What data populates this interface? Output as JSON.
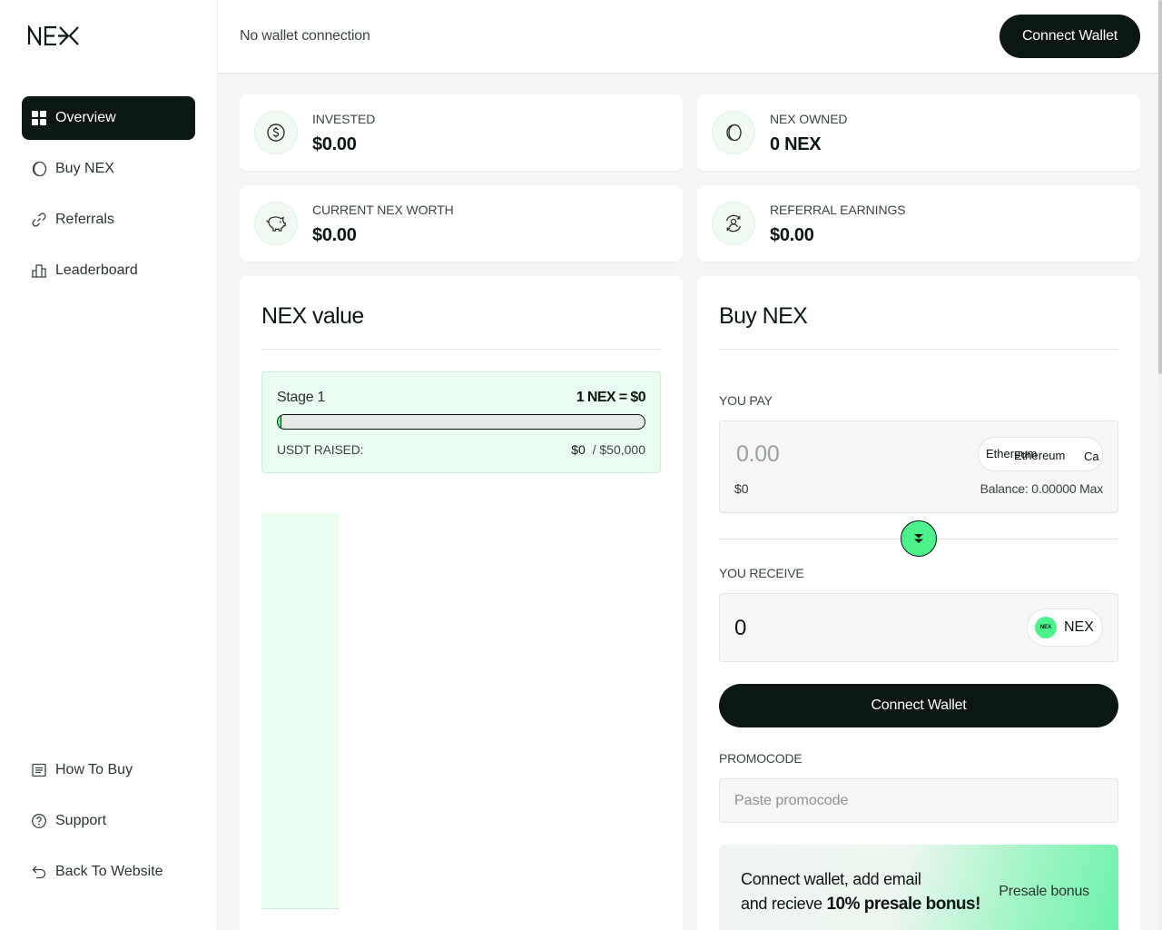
{
  "brand": {
    "logo_text": "NEX"
  },
  "sidebar": {
    "items": [
      {
        "label": "Overview",
        "icon": "grid-icon",
        "active": true
      },
      {
        "label": "Buy NEX",
        "icon": "coin-icon"
      },
      {
        "label": "Referrals",
        "icon": "link-icon"
      },
      {
        "label": "Leaderboard",
        "icon": "podium-icon"
      }
    ],
    "bottom_items": [
      {
        "label": "How To Buy",
        "icon": "document-icon"
      },
      {
        "label": "Support",
        "icon": "help-circle-icon"
      },
      {
        "label": "Back To Website",
        "icon": "return-arrow-icon"
      }
    ]
  },
  "header": {
    "status": "No wallet connection",
    "connect_label": "Connect Wallet"
  },
  "stats": [
    {
      "label": "INVESTED",
      "value": "$0.00",
      "icon": "dollar-circle-icon"
    },
    {
      "label": "NEX OWNED",
      "value": "0 NEX",
      "icon": "coin-icon"
    },
    {
      "label": "CURRENT NEX WORTH",
      "value": "$0.00",
      "icon": "piggy-bank-icon"
    },
    {
      "label": "REFERRAL EARNINGS",
      "value": "$0.00",
      "icon": "referral-cycle-icon"
    }
  ],
  "nex_value": {
    "title": "NEX value",
    "stage": "Stage 1",
    "rate": "1 NEX = $0",
    "progress_fraction": 0,
    "raised_label": "USDT RAISED:",
    "raised_value": "$0",
    "raised_target": "/ $50,000"
  },
  "buy": {
    "title": "Buy NEX",
    "pay_label": "YOU PAY",
    "pay_placeholder": "0.00",
    "pay_usd": "$0",
    "balance": "Balance: 0.00000 Max",
    "token_text_a": "Ethereum",
    "token_text_b": "Ethereum",
    "token_text_c": "Ca",
    "receive_label": "YOU RECEIVE",
    "receive_amount": "0",
    "receive_token": "NEX",
    "receive_coin_text": "NEX",
    "connect_label": "Connect Wallet",
    "promo_label": "PROMOCODE",
    "promo_placeholder": "Paste promocode",
    "bonus_line1": "Connect wallet, add email",
    "bonus_line2_prefix": "and recieve ",
    "bonus_line2_bold": "10% presale bonus!",
    "bonus_tag": "Presale bonus"
  },
  "colors": {
    "accent": "#4ef28a",
    "dark": "#0b1714",
    "mint": "#ebfdf0"
  }
}
